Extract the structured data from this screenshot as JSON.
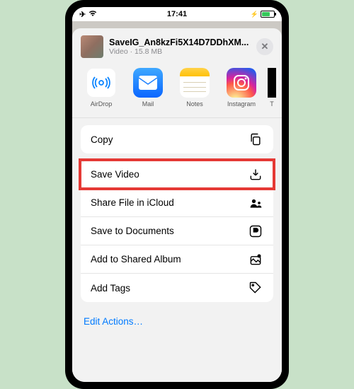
{
  "status": {
    "time": "17:41"
  },
  "file": {
    "name": "SaveIG_An8kzFi5X14D7DDhXM...",
    "meta": "Video · 15.8 MB"
  },
  "share_targets": [
    {
      "label": "AirDrop"
    },
    {
      "label": "Mail"
    },
    {
      "label": "Notes"
    },
    {
      "label": "Instagram"
    },
    {
      "label": "T"
    }
  ],
  "actions_group1": [
    {
      "label": "Copy"
    }
  ],
  "actions_group2": [
    {
      "label": "Save Video"
    },
    {
      "label": "Share File in iCloud"
    },
    {
      "label": "Save to Documents"
    },
    {
      "label": "Add to Shared Album"
    },
    {
      "label": "Add Tags"
    }
  ],
  "edit_actions": "Edit Actions…"
}
